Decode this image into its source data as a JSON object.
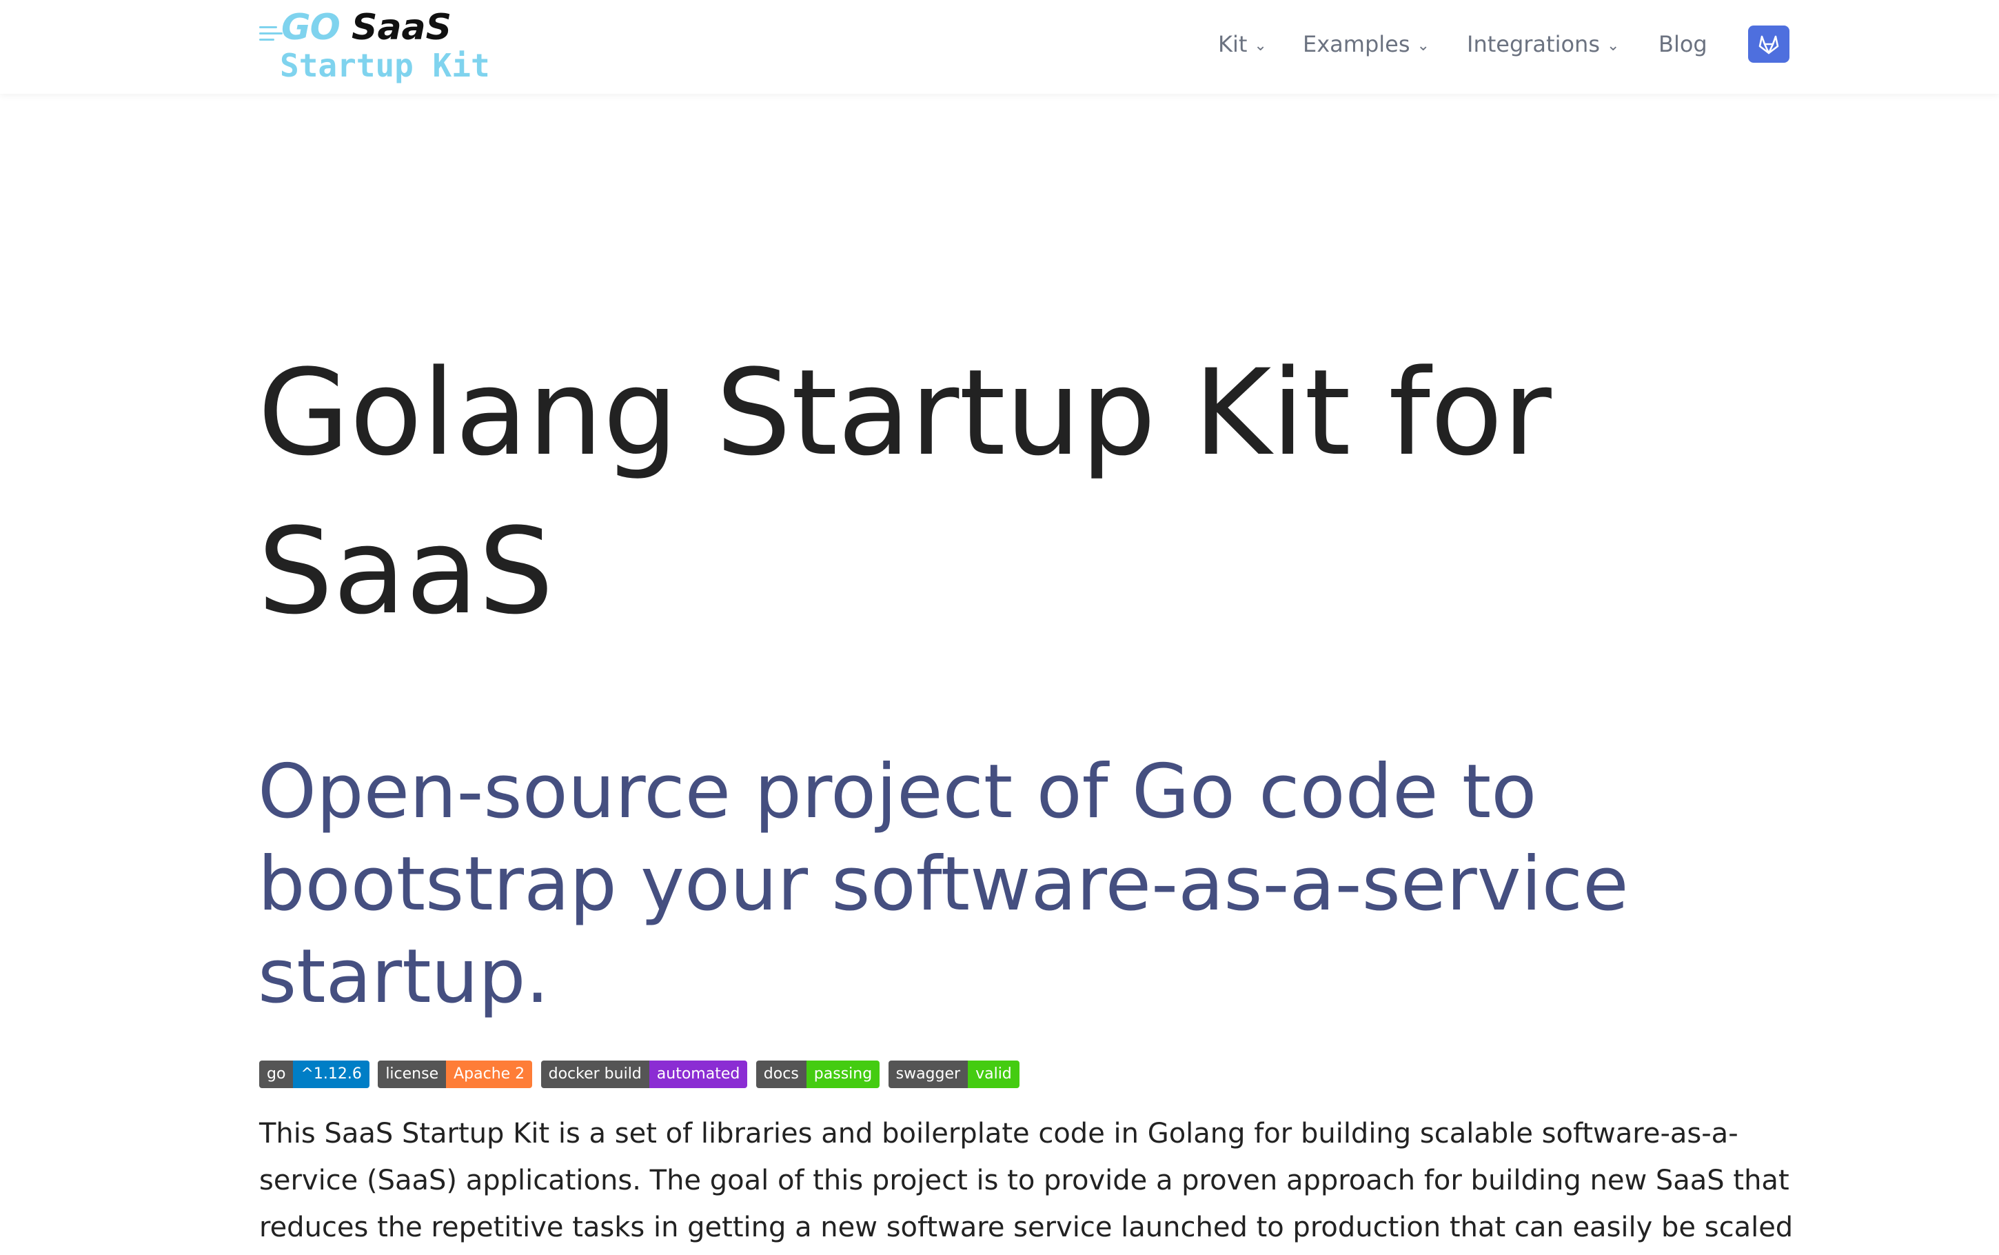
{
  "logo": {
    "go": "GO",
    "saas": "SaaS",
    "startup_kit": "Startup Kit"
  },
  "nav": {
    "items": [
      {
        "label": "Kit",
        "has_dropdown": true
      },
      {
        "label": "Examples",
        "has_dropdown": true
      },
      {
        "label": "Integrations",
        "has_dropdown": true
      },
      {
        "label": "Blog",
        "has_dropdown": false
      }
    ],
    "chevron": "⌄",
    "gitlab_icon": "gitlab-icon",
    "gitlab_color": "#4e6fde"
  },
  "hero": {
    "title_line1": "Golang Startup Kit for",
    "title_line2": "SaaS",
    "subtitle_line1": "Open-source project of Go code to",
    "subtitle_line2": "bootstrap your software-as-a-service",
    "subtitle_line3": "startup."
  },
  "badges": [
    {
      "label": "go",
      "value": "^1.12.6",
      "color": "#007ec6"
    },
    {
      "label": "license",
      "value": "Apache 2",
      "color": "#fe7d37"
    },
    {
      "label": "docker build",
      "value": "automated",
      "color": "#8b2dd3"
    },
    {
      "label": "docs",
      "value": "passing",
      "color": "#4c1"
    },
    {
      "label": "swagger",
      "value": "valid",
      "color": "#4c1"
    }
  ],
  "description": {
    "line1": "This SaaS Startup Kit is a set of libraries and boilerplate code in Golang for building scalable software-as-a-",
    "line2": "service (SaaS) applications. The goal of this project is to provide a proven approach for building new SaaS that",
    "line3": "reduces the repetitive tasks in getting a new software service launched to production that can easily be scaled"
  },
  "colors": {
    "title": "#222222",
    "subtitle": "#454f80",
    "logo_accent": "#7fd3ee",
    "nav_text": "#6b7280"
  }
}
